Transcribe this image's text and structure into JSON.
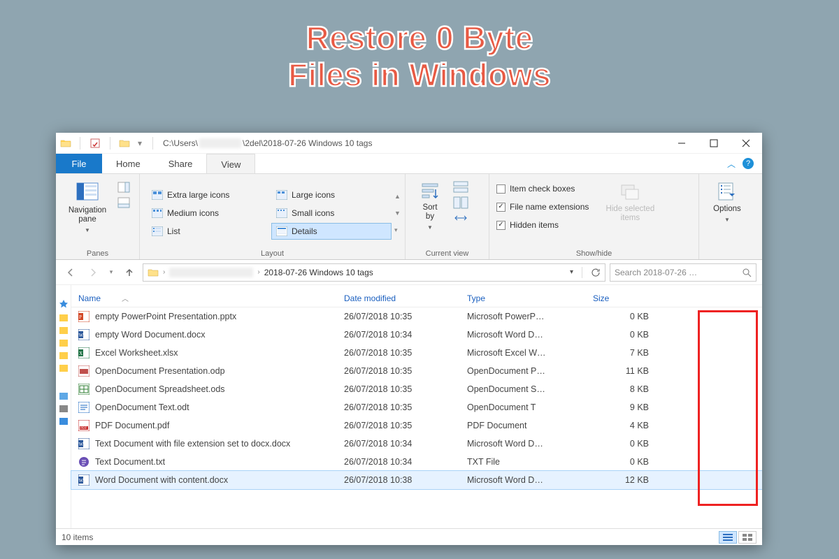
{
  "headline": {
    "line1": "Restore 0 Byte",
    "line2": "Files in Windows"
  },
  "titlebar": {
    "path_prefix": "C:\\Users\\",
    "path_suffix": "\\2del\\2018-07-26 Windows 10 tags"
  },
  "tabs": {
    "file": "File",
    "home": "Home",
    "share": "Share",
    "view": "View"
  },
  "ribbon": {
    "panes": {
      "nav_pane": "Navigation\npane",
      "group": "Panes"
    },
    "layout": {
      "extra_large": "Extra large icons",
      "large": "Large icons",
      "medium": "Medium icons",
      "small": "Small icons",
      "list": "List",
      "details": "Details",
      "group": "Layout"
    },
    "current_view": {
      "sort_by": "Sort\nby",
      "group": "Current view"
    },
    "show_hide": {
      "item_check_boxes": "Item check boxes",
      "file_name_ext": "File name extensions",
      "hidden_items": "Hidden items",
      "hide_selected": "Hide selected\nitems",
      "group": "Show/hide"
    },
    "options": "Options"
  },
  "addr": {
    "crumb": "2018-07-26 Windows 10 tags",
    "search_placeholder": "Search 2018-07-26 …"
  },
  "columns": {
    "name": "Name",
    "date": "Date modified",
    "type": "Type",
    "size": "Size"
  },
  "files": [
    {
      "icon": "ppt",
      "name": "empty PowerPoint Presentation.pptx",
      "date": "26/07/2018 10:35",
      "type": "Microsoft PowerP…",
      "size": "0 KB"
    },
    {
      "icon": "word",
      "name": "empty Word Document.docx",
      "date": "26/07/2018 10:34",
      "type": "Microsoft Word D…",
      "size": "0 KB"
    },
    {
      "icon": "xls",
      "name": "Excel Worksheet.xlsx",
      "date": "26/07/2018 10:35",
      "type": "Microsoft Excel W…",
      "size": "7 KB"
    },
    {
      "icon": "odp",
      "name": "OpenDocument Presentation.odp",
      "date": "26/07/2018 10:35",
      "type": "OpenDocument P…",
      "size": "11 KB"
    },
    {
      "icon": "ods",
      "name": "OpenDocument Spreadsheet.ods",
      "date": "26/07/2018 10:35",
      "type": "OpenDocument S…",
      "size": "8 KB"
    },
    {
      "icon": "odt",
      "name": "OpenDocument Text.odt",
      "date": "26/07/2018 10:35",
      "type": "OpenDocument T",
      "size": "9 KB"
    },
    {
      "icon": "pdf",
      "name": "PDF Document.pdf",
      "date": "26/07/2018 10:35",
      "type": "PDF Document",
      "size": "4 KB"
    },
    {
      "icon": "word",
      "name": "Text Document with file extension set to docx.docx",
      "date": "26/07/2018 10:34",
      "type": "Microsoft Word D…",
      "size": "0 KB"
    },
    {
      "icon": "txt",
      "name": "Text Document.txt",
      "date": "26/07/2018 10:34",
      "type": "TXT File",
      "size": "0 KB"
    },
    {
      "icon": "word",
      "name": "Word Document with content.docx",
      "date": "26/07/2018 10:38",
      "type": "Microsoft Word D…",
      "size": "12 KB",
      "selected": true
    }
  ],
  "status": {
    "count": "10 items"
  }
}
